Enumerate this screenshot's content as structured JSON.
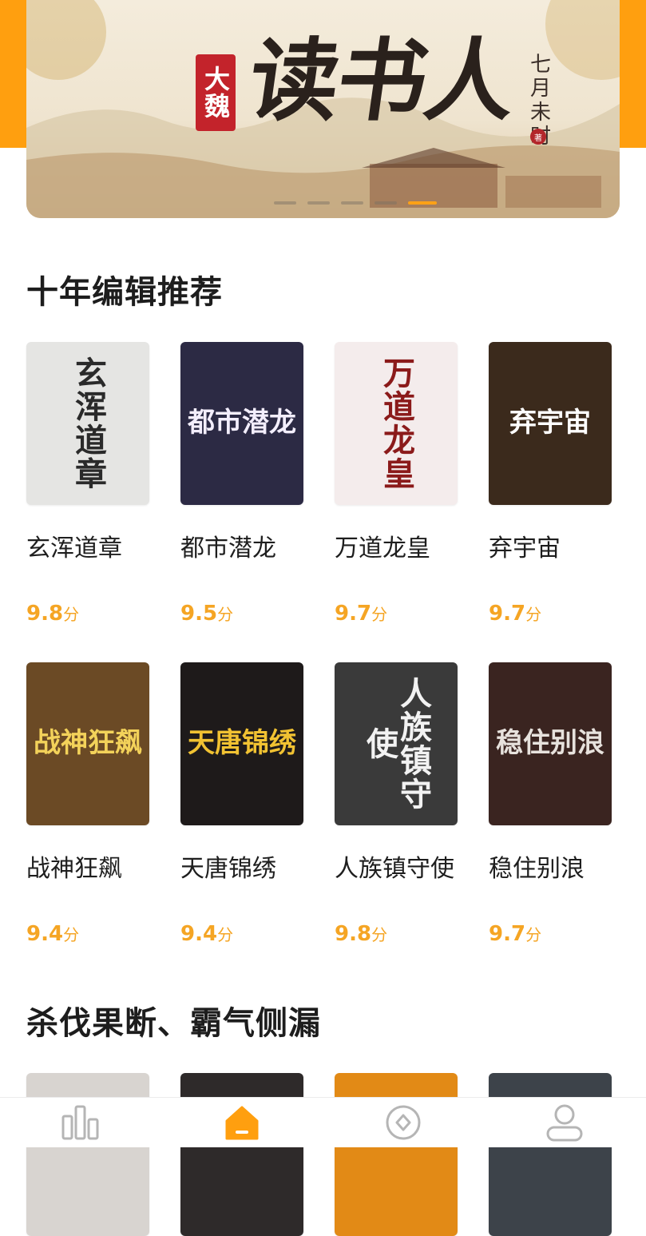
{
  "banner": {
    "seal": "大魏",
    "title": "读书人",
    "author": "七月未时",
    "stamp": "著",
    "dot_count": 5,
    "active_dot": 4
  },
  "sections": [
    {
      "title": "十年编辑推荐",
      "books": [
        {
          "name": "玄浑道章",
          "score": "9.8",
          "unit": "分",
          "cover_text": "玄浑道章",
          "cover_bg": "#e5e5e3",
          "cover_fg": "#2a2a2a",
          "vertical": true
        },
        {
          "name": "都市潜龙",
          "score": "9.5",
          "unit": "分",
          "cover_text": "都市潜龙",
          "cover_bg": "#2c2a44",
          "cover_fg": "#f3eefc",
          "vertical": false
        },
        {
          "name": "万道龙皇",
          "score": "9.7",
          "unit": "分",
          "cover_text": "万道龙皇",
          "cover_bg": "#f4ecec",
          "cover_fg": "#8b1a1a",
          "vertical": true
        },
        {
          "name": "弃宇宙",
          "score": "9.7",
          "unit": "分",
          "cover_text": "弃宇宙",
          "cover_bg": "#3b2a1c",
          "cover_fg": "#ffffff",
          "vertical": false
        }
      ]
    },
    {
      "books": [
        {
          "name": "战神狂飙",
          "score": "9.4",
          "unit": "分",
          "cover_text": "战神狂飙",
          "cover_bg": "#6b4a25",
          "cover_fg": "#f3d25a",
          "vertical": false
        },
        {
          "name": "天唐锦绣",
          "score": "9.4",
          "unit": "分",
          "cover_text": "天唐锦绣",
          "cover_bg": "#1e1a1a",
          "cover_fg": "#f1c232",
          "vertical": false
        },
        {
          "name": "人族镇守使",
          "score": "9.8",
          "unit": "分",
          "cover_text": "人族镇守使",
          "cover_bg": "#3a3a3a",
          "cover_fg": "#f2f2f2",
          "vertical": true
        },
        {
          "name": "稳住别浪",
          "score": "9.7",
          "unit": "分",
          "cover_text": "稳住别浪",
          "cover_bg": "#3a2420",
          "cover_fg": "#e7e2dd",
          "vertical": false
        }
      ]
    },
    {
      "title": "杀伐果断、霸气侧漏",
      "books": [
        {
          "cover_bg": "#d8d4d0"
        },
        {
          "cover_bg": "#2e2a2a"
        },
        {
          "cover_bg": "#e28a16"
        },
        {
          "cover_bg": "#3d434a"
        }
      ]
    }
  ],
  "nav": {
    "items": [
      {
        "icon": "rank-chart-icon",
        "active": false
      },
      {
        "icon": "home-icon",
        "active": true
      },
      {
        "icon": "discover-icon",
        "active": false
      },
      {
        "icon": "profile-icon",
        "active": false
      }
    ]
  },
  "colors": {
    "accent": "#ff9f0f",
    "score": "#f5a524",
    "nav_inactive": "#b5b5b5"
  }
}
